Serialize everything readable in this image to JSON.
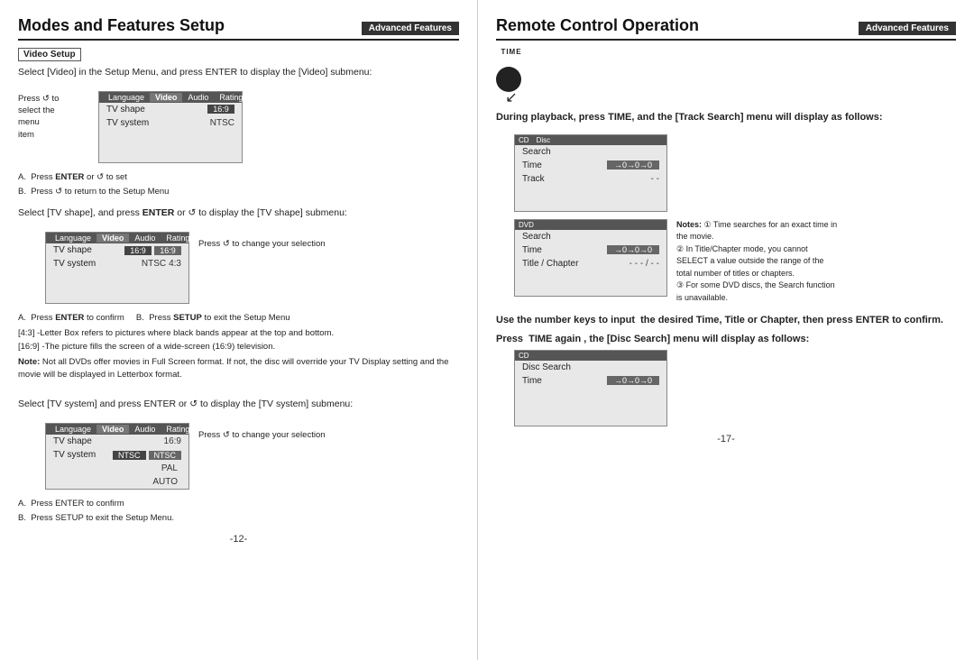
{
  "left": {
    "title": "Modes and Features Setup",
    "badge": "Advanced Features",
    "section_label": "Video Setup",
    "intro_text": "Select [Video] in the Setup Menu, and press ENTER to display the [Video] submenu:",
    "menu1": {
      "tabs": [
        "Language",
        "Video",
        "Audio",
        "Rating"
      ],
      "active_tab": "Video",
      "rows": [
        {
          "label": "TV shape",
          "value": "16:9",
          "highlight": true
        },
        {
          "label": "TV system",
          "value": "NTSC",
          "highlight": false
        }
      ]
    },
    "side_label1": "Press  to select the menu item",
    "instr1a": "A.  Press ENTER or",
    "instr1b": " to set",
    "instr1c": "B.  Press ",
    "instr1d": " to return to the Setup Menu",
    "tv_shape_text": "Select [TV shape], and press ENTER or  to display the [TV shape] submenu:",
    "menu2": {
      "tabs": [
        "Language",
        "Video",
        "Audio",
        "Rating"
      ],
      "active_tab": "Video",
      "rows": [
        {
          "label": "TV shape",
          "value1": "16:9",
          "value2": "16:9",
          "has_two": true
        },
        {
          "label": "TV system",
          "value1": "NTSC",
          "value2": "4:3",
          "has_two": true
        }
      ]
    },
    "press_change": "Press  to change your selection",
    "instr2a": "A.  Press ENTER to confirm",
    "instr2b": "  B.  Press SETUP to exit the Setup Menu",
    "note_43": "[4:3] -Letter Box refers to pictures where black bands appear at the top and bottom.",
    "note_169": "[16:9] -The picture fills the screen of a wide-screen (16:9) television.",
    "note_main": "Note: Not all DVDs offer movies in Full Screen format. If not, the disc will override your TV Display setting and the movie will be displayed in Letterbox format.",
    "tv_system_text": "Select [TV system] and press ENTER or  to display the [TV system] submenu:",
    "menu3": {
      "tabs": [
        "Language",
        "Video",
        "Audio",
        "Rating"
      ],
      "active_tab": "Video",
      "rows": [
        {
          "label": "TV shape",
          "value": "16:9"
        },
        {
          "label": "TV system",
          "value": "NTSC",
          "highlight": true,
          "options": [
            "NTSC",
            "PAL",
            "AUTO"
          ]
        }
      ]
    },
    "press_change3": "Press  to change your selection",
    "instr3a": "A.  Press ENTER to confirm",
    "instr3b": "B.  Press SETUP to exit the Setup Menu.",
    "page_num": "-12-"
  },
  "right": {
    "title": "Remote Control Operation",
    "badge": "Advanced Features",
    "time_label": "TIME",
    "playback_text": "During playback, press TIME, and the [Track Search] menu will display as follows:",
    "menu_cd": {
      "header": "CD    Disc",
      "rows": [
        {
          "label": "Search",
          "value": ""
        },
        {
          "label": "Time",
          "value": "->0->0->0"
        },
        {
          "label": "Track",
          "value": "- -"
        }
      ]
    },
    "menu_dvd": {
      "header": "DVD",
      "rows": [
        {
          "label": "Search",
          "value": ""
        },
        {
          "label": "Time",
          "value": "->0->0->0"
        },
        {
          "label": "Title / Chapter",
          "value": "- - - / - -"
        }
      ]
    },
    "notes_title": "Notes:",
    "notes": [
      "① Time searches for an exact time in the movie.",
      "② In Title/Chapter mode, you cannot SELECT a value outside the range of the total number of titles or chapters.",
      "③ For some DVD discs, the Search function is unavailable."
    ],
    "use_number_text": "Use the number keys to input  the desired Time, Title or Chapter, then press ENTER to confirm.",
    "press_time_text": "Press  TIME again , the [Disc Search] menu will display as follows:",
    "menu_disc": {
      "header": "CD",
      "rows": [
        {
          "label": "Disc Search",
          "value": ""
        },
        {
          "label": "Time",
          "value": "->0->0->0"
        }
      ]
    },
    "page_num": "-17-"
  }
}
